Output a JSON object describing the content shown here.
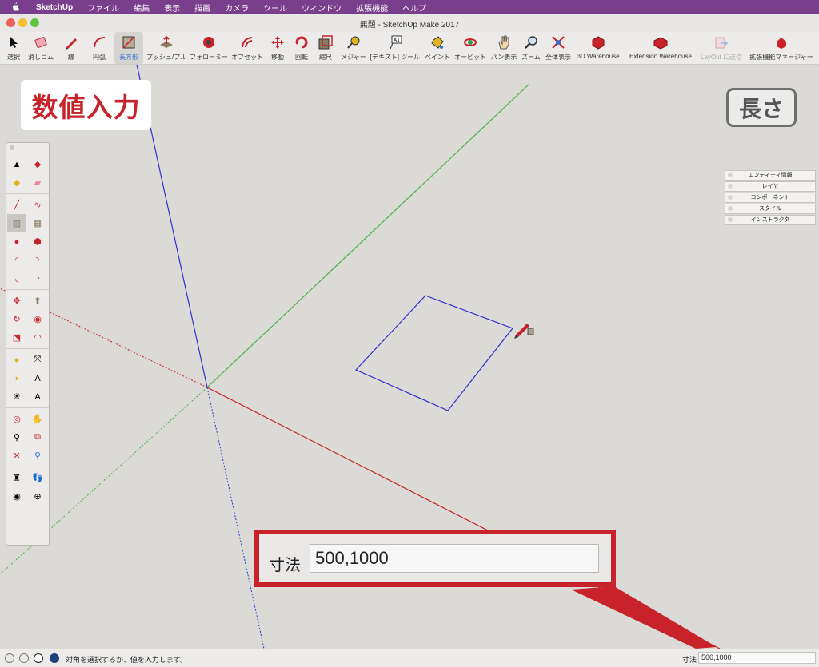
{
  "menubar": {
    "apple_icon": "apple-logo-icon",
    "items": [
      "SketchUp",
      "ファイル",
      "編集",
      "表示",
      "描画",
      "カメラ",
      "ツール",
      "ウィンドウ",
      "拡張機能",
      "ヘルプ"
    ]
  },
  "window": {
    "title": "無題 - SketchUp Make 2017"
  },
  "toolbar": {
    "items": [
      {
        "label": "選択",
        "icon": "select-arrow-icon"
      },
      {
        "label": "消しゴム",
        "icon": "eraser-icon"
      },
      {
        "label": "線",
        "icon": "pencil-line-icon"
      },
      {
        "label": "円弧",
        "icon": "arc-icon"
      },
      {
        "label": "長方形",
        "icon": "rectangle-icon"
      },
      {
        "label": "プッシュ/プル",
        "icon": "push-pull-icon"
      },
      {
        "label": "フォローミー",
        "icon": "follow-me-icon"
      },
      {
        "label": "オフセット",
        "icon": "offset-icon"
      },
      {
        "label": "移動",
        "icon": "move-icon"
      },
      {
        "label": "回転",
        "icon": "rotate-icon"
      },
      {
        "label": "縮尺",
        "icon": "scale-icon"
      },
      {
        "label": "メジャー",
        "icon": "tape-measure-icon"
      },
      {
        "label": "[テキスト] ツール",
        "icon": "text-tool-icon"
      },
      {
        "label": "ペイント",
        "icon": "paint-bucket-icon"
      },
      {
        "label": "オービット",
        "icon": "orbit-icon"
      },
      {
        "label": "パン表示",
        "icon": "pan-hand-icon"
      },
      {
        "label": "ズーム",
        "icon": "zoom-icon"
      },
      {
        "label": "全体表示",
        "icon": "zoom-extents-icon"
      },
      {
        "label": "3D Warehouse",
        "icon": "3d-warehouse-icon"
      },
      {
        "label": "Extension Warehouse",
        "icon": "extension-warehouse-icon"
      },
      {
        "label": "LayOut に送信",
        "icon": "layout-send-icon"
      },
      {
        "label": "拡張機能マネージャー",
        "icon": "extension-manager-icon"
      }
    ],
    "selected": "長方形"
  },
  "overlays": {
    "numeric_input": "数値入力",
    "length": "長さ"
  },
  "trays": [
    "エンティティ情報",
    "レイヤ",
    "コンポーネント",
    "スタイル",
    "インストラクタ"
  ],
  "vcb_callout": {
    "label": "寸法",
    "value": "500,1000"
  },
  "statusbar": {
    "message": "対角を選択するか、値を入力します。",
    "vcb_label": "寸法",
    "vcb_value": "500,1000",
    "icons": [
      "geo-location-icon",
      "credits-icon",
      "user-account-icon",
      "help-icon"
    ]
  },
  "colors": {
    "menubar": "#7a3f8c",
    "accent_red": "#c8232b",
    "axis_red": "#c8232b",
    "axis_green": "#49b34a",
    "axis_blue": "#2f2fd0",
    "selected_label": "#2f6fd6"
  }
}
